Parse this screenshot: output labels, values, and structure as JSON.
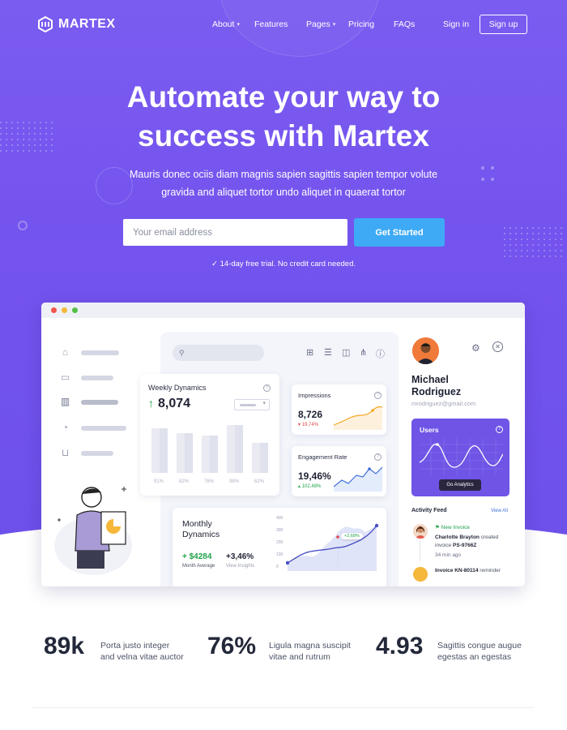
{
  "nav": {
    "brand": "MARTEX",
    "links": [
      {
        "label": "About",
        "caret": true
      },
      {
        "label": "Features",
        "caret": false
      },
      {
        "label": "Pages",
        "caret": true
      },
      {
        "label": "Pricing",
        "caret": false
      },
      {
        "label": "FAQs",
        "caret": false
      }
    ],
    "signin": "Sign in",
    "signup": "Sign up"
  },
  "hero": {
    "title_line1": "Automate your way to",
    "title_line2": "success with Martex",
    "subtitle_line1": "Mauris donec ociis diam magnis sapien sagittis sapien tempor volute",
    "subtitle_line2": "gravida and aliquet tortor undo aliquet in quaerat tortor",
    "email_placeholder": "Your email address",
    "cta": "Get Started",
    "trial_note": "14-day free trial. No credit card needed."
  },
  "dashboard": {
    "weekly": {
      "title": "Weekly Dynamics",
      "value": "8,074",
      "bar_labels": [
        "91%",
        "82%",
        "76%",
        "98%",
        "62%"
      ],
      "bar_levels": [
        0.91,
        0.82,
        0.76,
        0.98,
        0.62
      ]
    },
    "impressions": {
      "title": "Impressions",
      "value": "8,726",
      "delta": "19,74%"
    },
    "engagement": {
      "title": "Engagement Rate",
      "value": "19,46%",
      "delta": "102,48%"
    },
    "monthly": {
      "title_line1": "Monthly",
      "title_line2": "Dynamics",
      "amount": "+ $4284",
      "amount_label": "Month Average",
      "percent": "+3,46%",
      "percent_label": "View Insights",
      "y_ticks": [
        "400",
        "300",
        "200",
        "100",
        "0"
      ],
      "badge": "+2,68%"
    },
    "profile": {
      "name_line1": "Michael",
      "name_line2": "Rodriguez",
      "email": "mrodriguez@gmail.com"
    },
    "users": {
      "title": "Users",
      "button": "Go Analytics"
    },
    "activity": {
      "title": "Activity Feed",
      "view_all": "View All",
      "item1_tag": "New Invoice",
      "item1_name": "Charlotte Brayton",
      "item1_action": "created",
      "item1_text2": "invoice",
      "item1_invoice": "PS-9766Z",
      "item1_time": "34 min ago",
      "item2_invoice": "Invoice KN-80114",
      "item2_action": "reminder"
    },
    "search_icon": "search-icon"
  },
  "stats": [
    {
      "value": "89k",
      "line1": "Porta justo integer",
      "line2": "and velna vitae auctor"
    },
    {
      "value": "76%",
      "line1": "Ligula magna suscipit",
      "line2": "vitae and rutrum"
    },
    {
      "value": "4.93",
      "line1": "Sagittis congue augue",
      "line2": "egestas an egestas"
    }
  ],
  "colors": {
    "hero": "#7453ee",
    "cta": "#3eaaf6",
    "accent": "#6f54e6",
    "positive": "#1fa34a",
    "negative": "#e04848"
  }
}
